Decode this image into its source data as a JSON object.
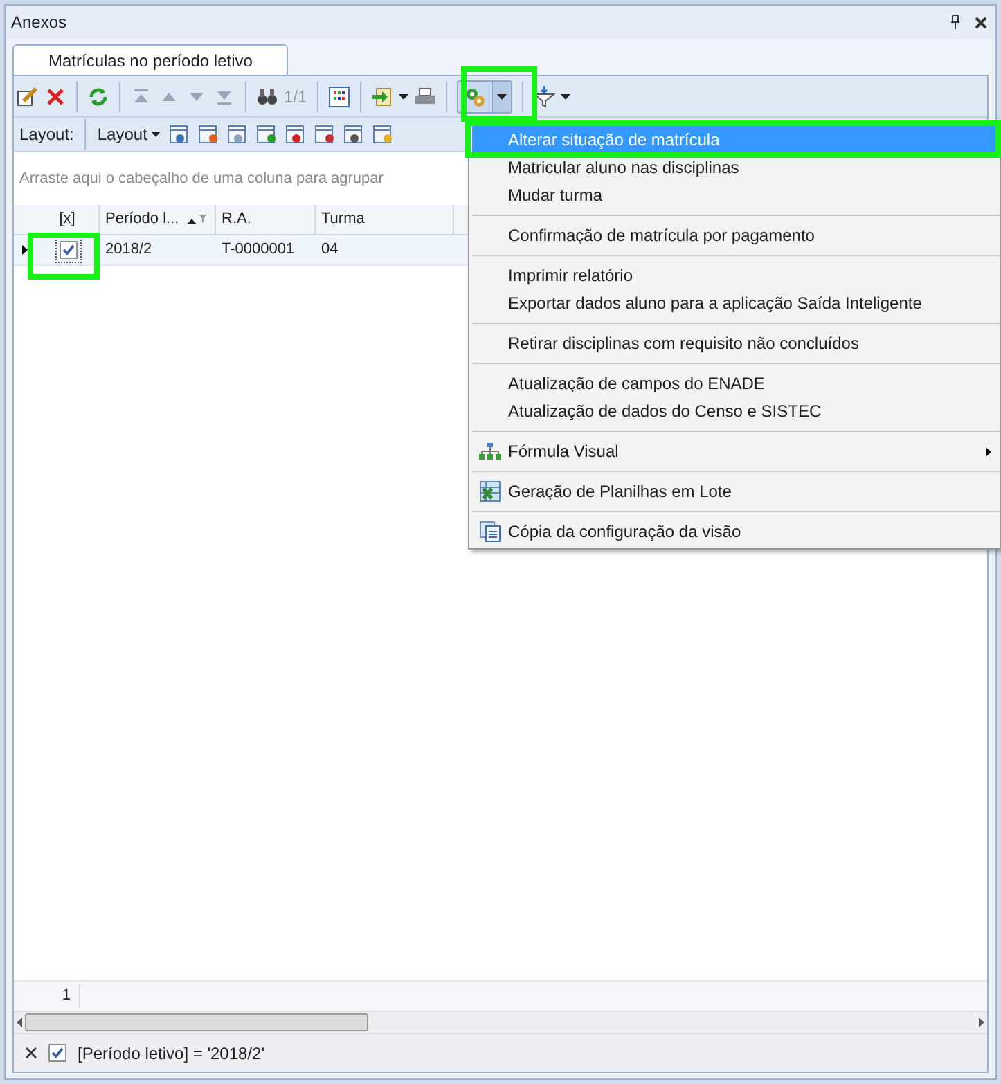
{
  "window": {
    "title": "Anexos"
  },
  "tabs": [
    {
      "label": "Matrículas no período letivo",
      "selected": true
    }
  ],
  "toolbar": {
    "pager": "1/1"
  },
  "layout_bar": {
    "label": "Layout:",
    "button": "Layout"
  },
  "group_panel": {
    "hint": "Arraste aqui o cabeçalho de uma coluna para agrupar"
  },
  "grid": {
    "check_column": "[x]",
    "columns": [
      "Período l...",
      "R.A.",
      "Turma"
    ],
    "rows": [
      {
        "selected": true,
        "checked": true,
        "cells": [
          "2018/2",
          "T-0000001",
          "04"
        ]
      }
    ],
    "footer_count": "1"
  },
  "filter": {
    "checked": true,
    "text": "[Período letivo] = '2018/2'"
  },
  "menu": {
    "items": [
      {
        "kind": "item",
        "label": "Alterar situação de matrícula",
        "selected": true
      },
      {
        "kind": "item",
        "label": "Matricular aluno nas disciplinas",
        "selected": false
      },
      {
        "kind": "item",
        "label": "Mudar turma",
        "selected": false
      },
      {
        "kind": "separator"
      },
      {
        "kind": "item",
        "label": "Confirmação de matrícula por pagamento",
        "selected": false
      },
      {
        "kind": "separator"
      },
      {
        "kind": "item",
        "label": "Imprimir relatório",
        "selected": false
      },
      {
        "kind": "item",
        "label": "Exportar dados aluno para a aplicação Saída Inteligente",
        "selected": false
      },
      {
        "kind": "separator"
      },
      {
        "kind": "item",
        "label": "Retirar disciplinas com requisito não concluídos",
        "selected": false
      },
      {
        "kind": "separator"
      },
      {
        "kind": "item",
        "label": "Atualização de campos do ENADE",
        "selected": false
      },
      {
        "kind": "item",
        "label": "Atualização de dados do Censo e SISTEC",
        "selected": false
      },
      {
        "kind": "separator"
      },
      {
        "kind": "tree",
        "label": "Fórmula Visual",
        "selected": false,
        "submenu": true
      },
      {
        "kind": "separator"
      },
      {
        "kind": "sheet",
        "label": "Geração de Planilhas em Lote",
        "selected": false
      },
      {
        "kind": "separator"
      },
      {
        "kind": "copy",
        "label": "Cópia da configuração da visão",
        "selected": false
      }
    ]
  }
}
